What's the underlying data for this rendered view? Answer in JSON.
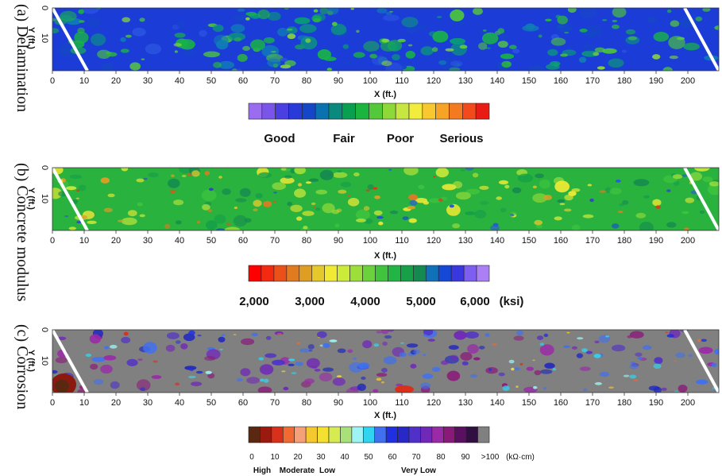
{
  "chart_data": [
    {
      "type": "heatmap",
      "panel_label": "(a) Delamination",
      "xlabel": "X (ft.)",
      "ylabel": "Y (ft.)",
      "xlim": [
        0,
        203
      ],
      "ylim": [
        0,
        20
      ],
      "x_ticks": [
        "0",
        "10",
        "20",
        "30",
        "40",
        "50",
        "60",
        "70",
        "80",
        "90",
        "100",
        "110",
        "120",
        "130",
        "140",
        "150",
        "160",
        "170",
        "180",
        "190",
        "200"
      ],
      "y_ticks": [
        "0",
        "10"
      ],
      "colorbar": {
        "colors": [
          "#9a6cf0",
          "#7a55ea",
          "#4a3fe0",
          "#2a3ad8",
          "#1646c8",
          "#0b72b0",
          "#0a8a7e",
          "#08a050",
          "#1ab43e",
          "#52c83a",
          "#8ed83a",
          "#c8e640",
          "#f2ec3c",
          "#f8c82e",
          "#f6a326",
          "#f47a20",
          "#f24a1a",
          "#e81c14"
        ],
        "category_labels": [
          "Good",
          "Fair",
          "Poor",
          "Serious"
        ]
      },
      "field": {
        "dominant": "Good (blue)",
        "patches": "Fair (green)"
      }
    },
    {
      "type": "heatmap",
      "panel_label": "(b) Concrete modulus",
      "xlabel": "X (ft.)",
      "ylabel": "Y (ft.)",
      "xlim": [
        0,
        203
      ],
      "ylim": [
        0,
        20
      ],
      "x_ticks": [
        "0",
        "10",
        "20",
        "30",
        "40",
        "50",
        "60",
        "70",
        "80",
        "90",
        "100",
        "110",
        "120",
        "130",
        "140",
        "150",
        "160",
        "170",
        "180",
        "190",
        "200"
      ],
      "y_ticks": [
        "0",
        "10"
      ],
      "colorbar": {
        "colors": [
          "#ff0000",
          "#f42a10",
          "#ea5018",
          "#e27a20",
          "#de9e24",
          "#e4c82c",
          "#f0ea34",
          "#ccea3a",
          "#9cde3a",
          "#6cd23c",
          "#40c43e",
          "#22b444",
          "#16a048",
          "#148a50",
          "#1070b8",
          "#1648d8",
          "#3a36e0",
          "#7e5ef0",
          "#aa80f4"
        ],
        "tick_labels": [
          "2,000",
          "3,000",
          "4,000",
          "5,000",
          "6,000"
        ],
        "unit": "(ksi)"
      },
      "field": {
        "dominant": "green (about 4,500 - 5,500 ksi)",
        "patches": "yellow-orange-red (about 2,000 - 3,500 ksi) and blue (about 6,000 ksi)"
      }
    },
    {
      "type": "heatmap",
      "panel_label": "(c) Corrosion",
      "xlabel": "X (ft.)",
      "ylabel": "Y (ft.)",
      "xlim": [
        0,
        203
      ],
      "ylim": [
        0,
        20
      ],
      "x_ticks": [
        "0",
        "10",
        "20",
        "30",
        "40",
        "50",
        "60",
        "70",
        "80",
        "90",
        "100",
        "110",
        "120",
        "130",
        "140",
        "150",
        "160",
        "170",
        "180",
        "190",
        "200"
      ],
      "y_ticks": [
        "0",
        "10"
      ],
      "colorbar": {
        "colors": [
          "#5a2810",
          "#9a1a10",
          "#d8301a",
          "#f06a32",
          "#f4a078",
          "#f6c830",
          "#f4e030",
          "#d6ea52",
          "#a8e07a",
          "#9ef4f4",
          "#30d4f0",
          "#4070f0",
          "#2030e0",
          "#2828c8",
          "#5030c8",
          "#7028b8",
          "#9a2aa8",
          "#8a1a7a",
          "#5a1060",
          "#301040",
          "#808080"
        ],
        "tick_labels": [
          "0",
          "10",
          "20",
          "30",
          "40",
          "50",
          "60",
          "70",
          "80",
          "90",
          ">100"
        ],
        "unit": "(kΩ·cm)",
        "category_labels": [
          "High",
          "Moderate",
          "Low",
          "Very Low"
        ]
      },
      "field": {
        "dominant": ">100 kΩ·cm (gray)",
        "patches": "purple/blue (about 60 - 90 kΩ·cm) with small yellow and red spots"
      }
    }
  ]
}
